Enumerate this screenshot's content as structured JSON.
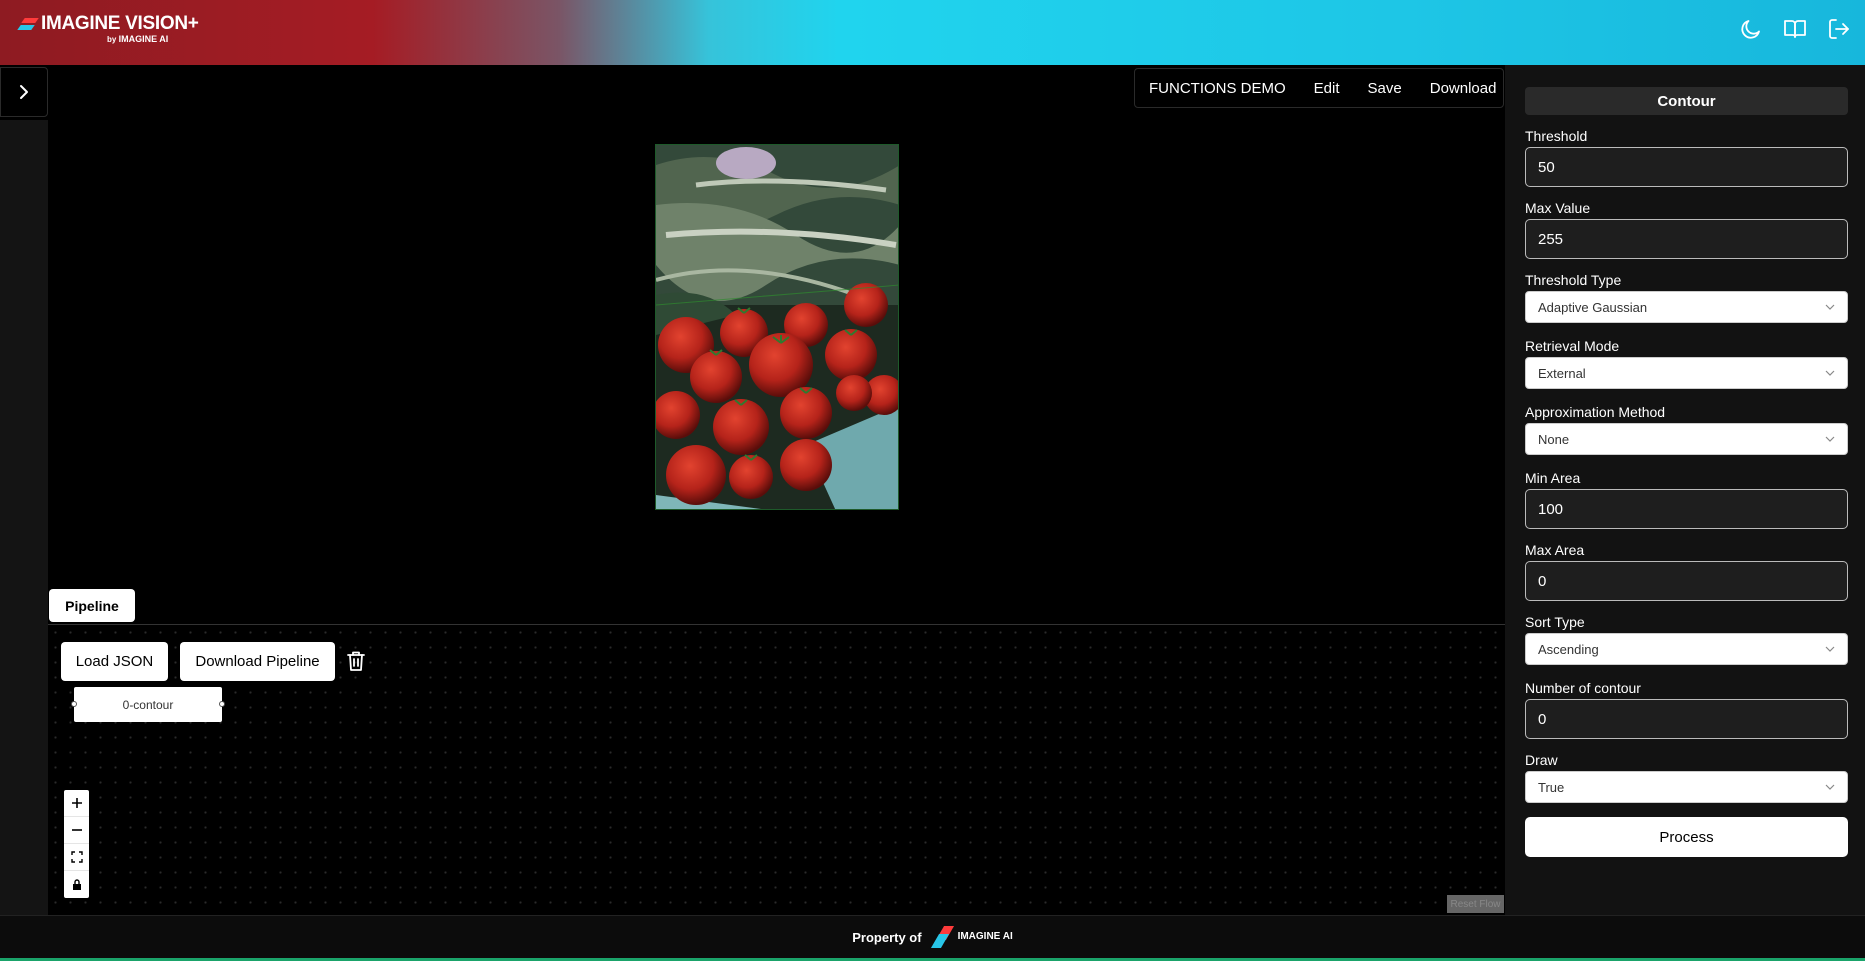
{
  "header": {
    "logo_text": "IMAGINE VISION+",
    "logo_sub_prefix": "by",
    "logo_sub_brand": "IMAGINE AI",
    "icons": [
      "moon-icon",
      "book-open-icon",
      "logout-icon"
    ]
  },
  "toolbar": {
    "demo_label": "FUNCTIONS DEMO",
    "edit_label": "Edit",
    "save_label": "Save",
    "download_label": "Download"
  },
  "pipeline": {
    "tab_label": "Pipeline",
    "load_json_label": "Load JSON",
    "download_pipeline_label": "Download Pipeline",
    "node_label": "0-contour",
    "reset_flow_label": "Reset Flow"
  },
  "panel": {
    "title": "Contour",
    "threshold": {
      "label": "Threshold",
      "value": "50"
    },
    "max_value": {
      "label": "Max Value",
      "value": "255"
    },
    "threshold_type": {
      "label": "Threshold Type",
      "value": "Adaptive Gaussian"
    },
    "retrieval_mode": {
      "label": "Retrieval Mode",
      "value": "External"
    },
    "approximation_method": {
      "label": "Approximation Method",
      "value": "None"
    },
    "min_area": {
      "label": "Min Area",
      "value": "100"
    },
    "max_area": {
      "label": "Max Area",
      "value": "0"
    },
    "sort_type": {
      "label": "Sort Type",
      "value": "Ascending"
    },
    "number_of_contour": {
      "label": "Number of contour",
      "value": "0"
    },
    "draw": {
      "label": "Draw",
      "value": "True"
    },
    "process_label": "Process"
  },
  "footer": {
    "property_label": "Property of",
    "brand": "IMAGINE AI"
  }
}
